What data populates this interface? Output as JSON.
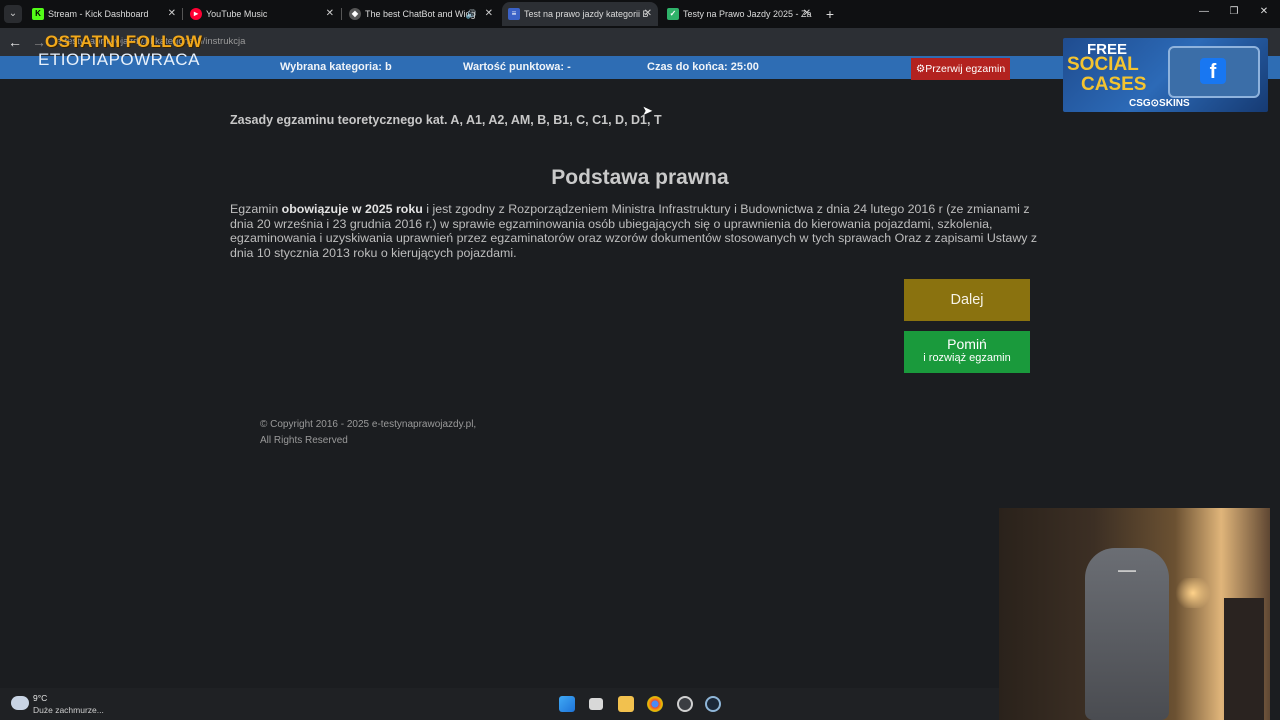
{
  "browser": {
    "tabs": [
      {
        "title": "Stream - Kick Dashboard",
        "favicon": "K",
        "color": "#53fc18",
        "active": false
      },
      {
        "title": "YouTube Music",
        "favicon": "▶",
        "color": "#ff0033",
        "active": false
      },
      {
        "title": "The best ChatBot and Widg",
        "favicon": "◆",
        "color": "#666666",
        "active": false,
        "audio": true
      },
      {
        "title": "Test na prawo jazdy kategorii B",
        "favicon": "≡",
        "color": "#3b62c7",
        "active": true
      },
      {
        "title": "Testy na Prawo Jazdy 2025 - Za",
        "favicon": "✓",
        "color": "#2fb36a",
        "active": false
      }
    ],
    "url": "e-testynaprawojazdy.pl/kategoria-b/instrukcja"
  },
  "overlay": {
    "follow_text": "OSTATNI FOLLOW"
  },
  "site": {
    "logo": "ETIOPIAPOWRACA",
    "category": "Wybrana kategoria: b",
    "points": "Wartość punktowa: -",
    "timer": "Czas do końca: 25:00",
    "stop_label": "⚙Przerwij egzamin"
  },
  "content": {
    "rules_title": "Zasady egzaminu teoretycznego kat. A, A1, A2, AM, B, B1, C, C1, D, D1, T",
    "section_title": "Podstawa prawna",
    "intro_prefix": "Egzamin ",
    "intro_bold": "obowiązuje w 2025 roku",
    "intro_rest": " i jest zgodny z Rozporządzeniem Ministra Infrastruktury i Budownictwa z dnia 24 lutego 2016 r (ze zmianami z dnia 20 września i 23 grudnia 2016 r.) w sprawie egzaminowania osób ubiegających się o uprawnienia do kierowania pojazdami, szkolenia, egzaminowania i uzyskiwania uprawnień przez egzaminatorów oraz wzorów dokumentów stosowanych w tych sprawach Oraz z zapisami Ustawy z dnia 10 stycznia 2013 roku o kierujących pojazdami.",
    "next_label": "Dalej",
    "skip_label_1": "Pomiń",
    "skip_label_2": "i rozwiąż egzamin"
  },
  "footer": {
    "copyright": "© Copyright 2016 - 2025 e-testynaprawojazdy.pl,",
    "rights": "All Rights Reserved"
  },
  "ad": {
    "line1": "FREE",
    "line2": "SOCIAL",
    "line3": "CASES",
    "brand": "CSG⊙SKINS"
  },
  "taskbar": {
    "temperature": "9°C",
    "weather": "Duże zachmurze...",
    "icons": [
      "windows-icon",
      "task-view-icon",
      "file-explorer-icon",
      "chrome-icon",
      "obs-icon",
      "steam-icon"
    ]
  }
}
